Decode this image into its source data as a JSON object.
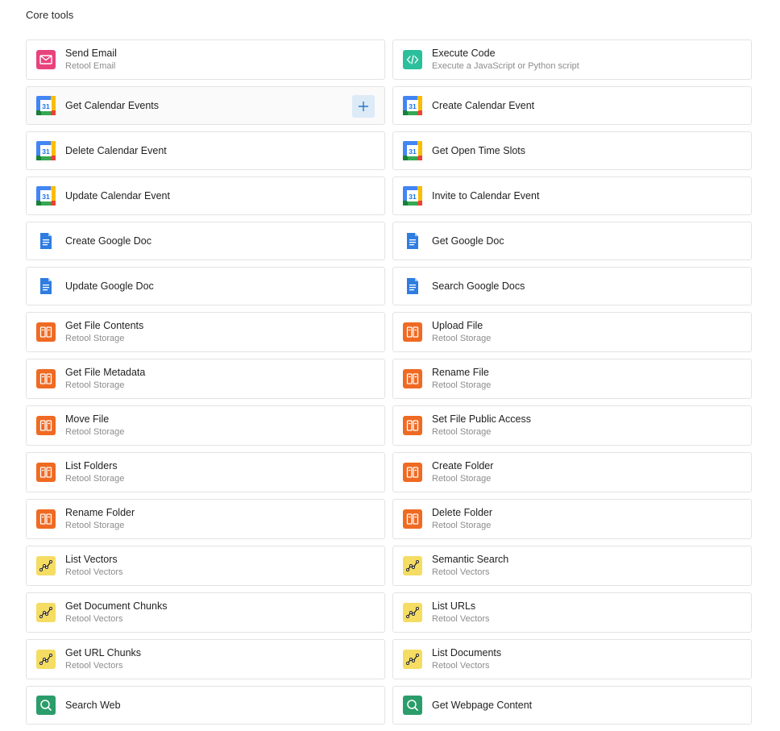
{
  "section": {
    "title": "Core tools"
  },
  "colors": {
    "email": "#e8427c",
    "code": "#2bbf9b",
    "storage": "#ef6a22",
    "vectors": "#f5dc62",
    "web": "#2a9d6a",
    "docs": "#2f7de1",
    "add_button_bg": "#dcebf7",
    "add_button_fg": "#2a78c2"
  },
  "add_button": {
    "label": "+"
  },
  "rows": [
    [
      {
        "title": "Send Email",
        "subtitle": "Retool Email",
        "icon": "email-icon"
      },
      {
        "title": "Execute Code",
        "subtitle": "Execute a JavaScript or Python script",
        "icon": "code-icon"
      }
    ],
    [
      {
        "title": "Get Calendar Events",
        "subtitle": "",
        "icon": "calendar-icon",
        "icon_text": "31",
        "hovered": true
      },
      {
        "title": "Create Calendar Event",
        "subtitle": "",
        "icon": "calendar-icon",
        "icon_text": "31"
      }
    ],
    [
      {
        "title": "Delete Calendar Event",
        "subtitle": "",
        "icon": "calendar-icon",
        "icon_text": "31"
      },
      {
        "title": "Get Open Time Slots",
        "subtitle": "",
        "icon": "calendar-icon",
        "icon_text": "31"
      }
    ],
    [
      {
        "title": "Update Calendar Event",
        "subtitle": "",
        "icon": "calendar-icon",
        "icon_text": "31"
      },
      {
        "title": "Invite to Calendar Event",
        "subtitle": "",
        "icon": "calendar-icon",
        "icon_text": "31"
      }
    ],
    [
      {
        "title": "Create Google Doc",
        "subtitle": "",
        "icon": "google-doc-icon"
      },
      {
        "title": "Get Google Doc",
        "subtitle": "",
        "icon": "google-doc-icon"
      }
    ],
    [
      {
        "title": "Update Google Doc",
        "subtitle": "",
        "icon": "google-doc-icon"
      },
      {
        "title": "Search Google Docs",
        "subtitle": "",
        "icon": "google-doc-icon"
      }
    ],
    [
      {
        "title": "Get File Contents",
        "subtitle": "Retool Storage",
        "icon": "storage-icon"
      },
      {
        "title": "Upload File",
        "subtitle": "Retool Storage",
        "icon": "storage-icon"
      }
    ],
    [
      {
        "title": "Get File Metadata",
        "subtitle": "Retool Storage",
        "icon": "storage-icon"
      },
      {
        "title": "Rename File",
        "subtitle": "Retool Storage",
        "icon": "storage-icon"
      }
    ],
    [
      {
        "title": "Move File",
        "subtitle": "Retool Storage",
        "icon": "storage-icon"
      },
      {
        "title": "Set File Public Access",
        "subtitle": "Retool Storage",
        "icon": "storage-icon"
      }
    ],
    [
      {
        "title": "List Folders",
        "subtitle": "Retool Storage",
        "icon": "storage-icon"
      },
      {
        "title": "Create Folder",
        "subtitle": "Retool Storage",
        "icon": "storage-icon"
      }
    ],
    [
      {
        "title": "Rename Folder",
        "subtitle": "Retool Storage",
        "icon": "storage-icon"
      },
      {
        "title": "Delete Folder",
        "subtitle": "Retool Storage",
        "icon": "storage-icon"
      }
    ],
    [
      {
        "title": "List Vectors",
        "subtitle": "Retool Vectors",
        "icon": "vectors-icon"
      },
      {
        "title": "Semantic Search",
        "subtitle": "Retool Vectors",
        "icon": "vectors-icon"
      }
    ],
    [
      {
        "title": "Get Document Chunks",
        "subtitle": "Retool Vectors",
        "icon": "vectors-icon"
      },
      {
        "title": "List URLs",
        "subtitle": "Retool Vectors",
        "icon": "vectors-icon"
      }
    ],
    [
      {
        "title": "Get URL Chunks",
        "subtitle": "Retool Vectors",
        "icon": "vectors-icon"
      },
      {
        "title": "List Documents",
        "subtitle": "Retool Vectors",
        "icon": "vectors-icon"
      }
    ],
    [
      {
        "title": "Search Web",
        "subtitle": "",
        "icon": "web-search-icon"
      },
      {
        "title": "Get Webpage Content",
        "subtitle": "",
        "icon": "web-search-icon"
      }
    ]
  ]
}
